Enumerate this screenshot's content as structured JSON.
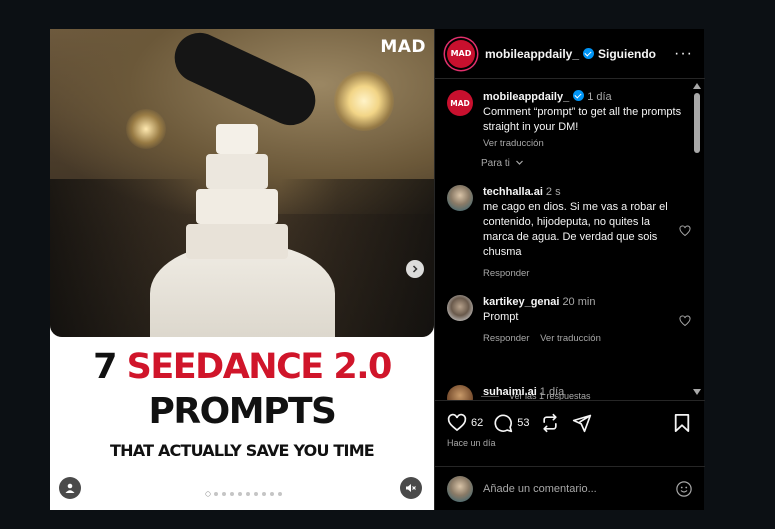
{
  "media": {
    "watermark": "MAD",
    "headline_number": "7",
    "headline_red": "SEEDANCE 2.0",
    "headline_line2": "PROMPTS",
    "subline": "THAT ACTUALLY SAVE YOU TIME",
    "carousel_total": 10,
    "carousel_active": 1
  },
  "header": {
    "avatar_text": "MAD",
    "username": "mobileappdaily_",
    "follow_label": "Siguiendo",
    "more_label": "···"
  },
  "caption": {
    "avatar_text": "MAD",
    "username": "mobileappdaily_",
    "time": "1 día",
    "text": "Comment “prompt” to get all the prompts straight in your DM!",
    "translate": "Ver traducción"
  },
  "for_you": "Para ti",
  "comments": [
    {
      "username": "techhalla.ai",
      "time": "2 s",
      "text": "me cago en dios. Si me vas a robar el contenido, hijodeputa, no quites la marca de agua. De verdad que sois chusma",
      "reply": "Responder"
    },
    {
      "username": "kartikey_genai",
      "time": "20 min",
      "text": "Prompt",
      "reply": "Responder",
      "translate": "Ver traducción",
      "view_replies": "Ver las 1 respuestas"
    },
    {
      "username": "suhaimi.ai",
      "time": "1 día"
    }
  ],
  "actions": {
    "likes": "62",
    "comments": "53",
    "posted": "Hace un día"
  },
  "add_comment": {
    "placeholder": "Añade un comentario..."
  },
  "colors": {
    "accent_red": "#d0152a",
    "verified_blue": "#0095f6",
    "background": "#000000"
  }
}
